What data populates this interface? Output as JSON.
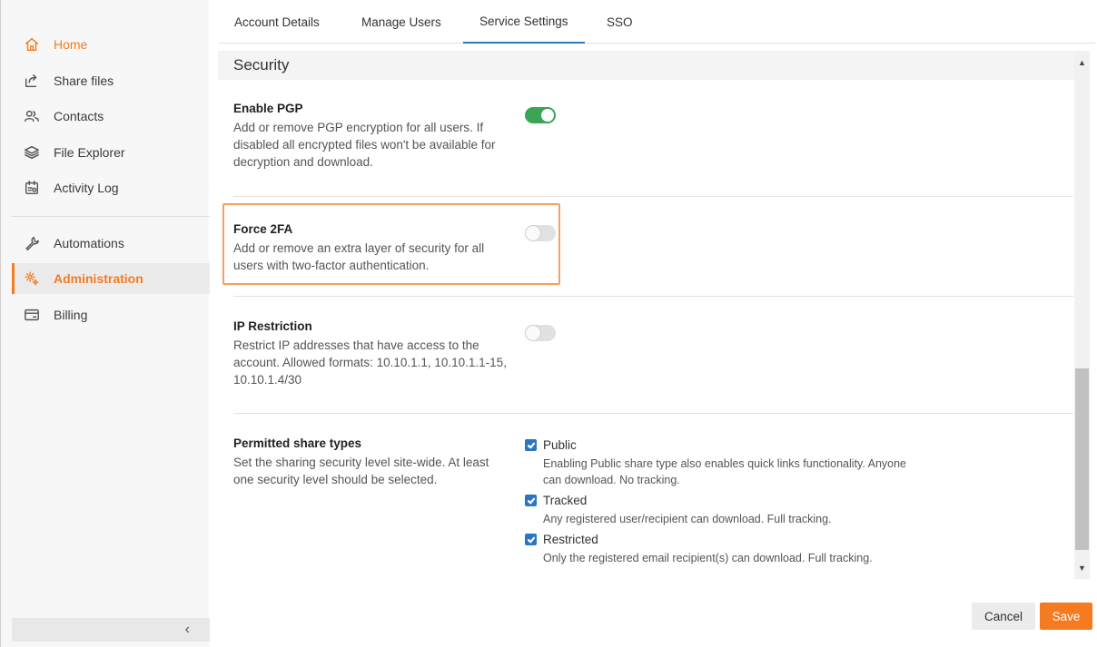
{
  "sidebar": {
    "items": [
      {
        "label": "Home",
        "icon": "home-icon"
      },
      {
        "label": "Share files",
        "icon": "share-icon"
      },
      {
        "label": "Contacts",
        "icon": "contacts-icon"
      },
      {
        "label": "File Explorer",
        "icon": "layers-icon"
      },
      {
        "label": "Activity Log",
        "icon": "activity-log-icon"
      },
      {
        "label": "Automations",
        "icon": "wrench-icon"
      },
      {
        "label": "Administration",
        "icon": "gear-icon"
      },
      {
        "label": "Billing",
        "icon": "card-icon"
      }
    ],
    "active_item": "Administration",
    "collapse_glyph": "‹"
  },
  "tabs": [
    {
      "label": "Account Details"
    },
    {
      "label": "Manage Users"
    },
    {
      "label": "Service Settings"
    },
    {
      "label": "SSO"
    }
  ],
  "active_tab": "Service Settings",
  "section": {
    "title": "Security"
  },
  "settings": {
    "pgp": {
      "title": "Enable PGP",
      "description": "Add or remove PGP encryption for all users. If disabled all encrypted files won't be available for decryption and download.",
      "enabled": true
    },
    "force2fa": {
      "title": "Force 2FA",
      "description": "Add or remove an extra layer of security for all users with two-factor authentication.",
      "enabled": false
    },
    "ip_restriction": {
      "title": "IP Restriction",
      "description": "Restrict IP addresses that have access to the account. Allowed formats: 10.10.1.1, 10.10.1.1-15, 10.10.1.4/30",
      "enabled": false
    },
    "share_types": {
      "title": "Permitted share types",
      "description": "Set the sharing security level site-wide. At least one security level should be selected.",
      "options": [
        {
          "label": "Public",
          "checked": true,
          "description": "Enabling Public share type also enables quick links functionality. Anyone can download. No tracking."
        },
        {
          "label": "Tracked",
          "checked": true,
          "description": "Any registered user/recipient can download. Full tracking."
        },
        {
          "label": "Restricted",
          "checked": true,
          "description": "Only the registered email recipient(s) can download. Full tracking."
        }
      ]
    }
  },
  "footer": {
    "cancel_label": "Cancel",
    "save_label": "Save"
  },
  "colors": {
    "accent": "#f47b20",
    "toggle_on": "#3aa655",
    "checkbox": "#2a76c4",
    "tab_underline": "#2e78c2",
    "highlight_border": "#f0a060"
  }
}
